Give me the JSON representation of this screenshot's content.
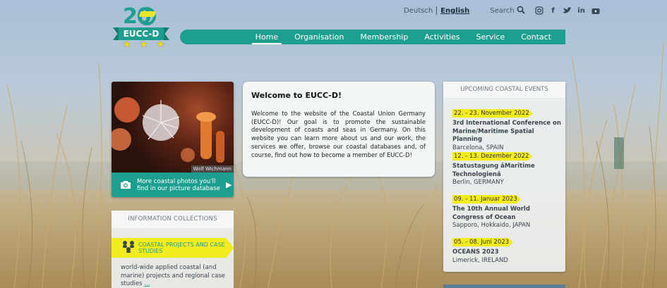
{
  "logo": {
    "number": "20",
    "name": "EUCC-D",
    "stars": "★ ★ ★"
  },
  "header": {
    "languages": [
      {
        "label": "Deutsch",
        "active": false
      },
      {
        "label": "English",
        "active": true
      }
    ],
    "search_label": "Search",
    "social_icons": [
      "instagram-icon",
      "facebook-icon",
      "twitter-icon",
      "linkedin-icon",
      "youtube-icon"
    ]
  },
  "nav": {
    "items": [
      {
        "label": "Home",
        "active": true
      },
      {
        "label": "Organisation",
        "active": false
      },
      {
        "label": "Membership",
        "active": false
      },
      {
        "label": "Activities",
        "active": false
      },
      {
        "label": "Service",
        "active": false
      },
      {
        "label": "Contact",
        "active": false
      }
    ]
  },
  "photo_card": {
    "credit": "Wolf Wichmann",
    "cta": "More coastal photos you'll find in our picture database"
  },
  "info": {
    "heading": "INFORMATION COLLECTIONS",
    "item_label": "COASTAL PROJECTS AND CASE STUDIES",
    "description": "world-wide applied coastal (and marine) projects and regional case studies",
    "more": "..."
  },
  "welcome": {
    "title": "Welcome to EUCC-D!",
    "body": "Welcome to the website of the Coastal Union Germany (EUCC-D)! Our goal is to promote the sustainable development of coasts and seas in Germany. On this website you can learn more about us and our work, the services we offer, browse our coastal databases and, of course, find out how to become a member of EUCC-D!"
  },
  "events": {
    "heading": "UPCOMING COASTAL EVENTS",
    "items": [
      {
        "date": "22. - 23. November 2022",
        "title": "3rd International Conference on Marine/Maritime Spatial Planning",
        "place": "Barcelona, SPAIN"
      },
      {
        "date": "12. - 13. Dezember 2022",
        "title": "Statustagung âMaritime Technologienâ",
        "place": "Berlin, GERMANY"
      },
      {
        "date": "09. - 11. Januar 2023",
        "title": "The 10th Annual World Congress of Ocean",
        "place": "Sapporo, Hokkaido, JAPAN"
      },
      {
        "date": "05. - 08. Juni 2023",
        "title": "OCEANS 2023",
        "place": "Limerick, IRELAND"
      }
    ]
  },
  "colors": {
    "brand": "#1e9e8e",
    "highlight": "#f3ec1c"
  }
}
